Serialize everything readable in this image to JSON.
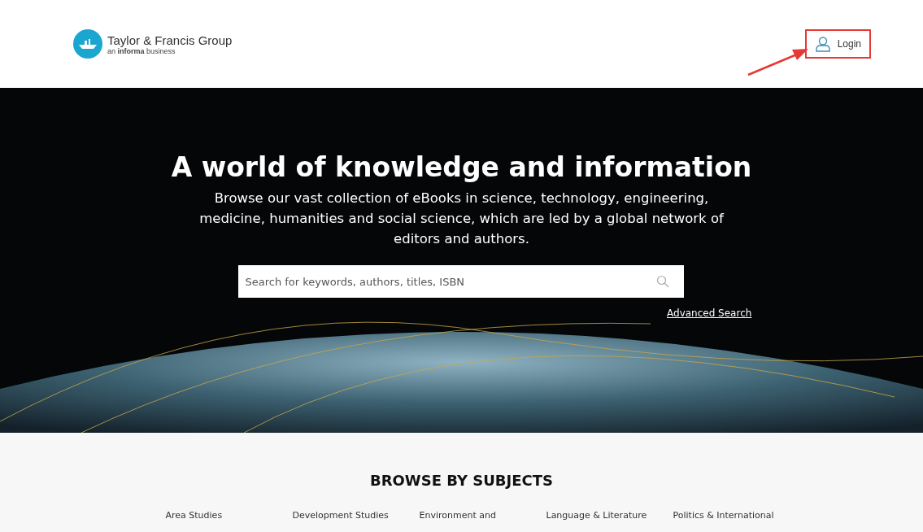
{
  "header": {
    "logo_title": "Taylor & Francis Group",
    "logo_tagline": "an **informa** business",
    "login": "Login"
  },
  "hero": {
    "title": "A world of knowledge and information",
    "description": "Browse our vast collection of eBooks in science, technology, engineering, medicine, humanities and social science, which are led by a global network of editors and authors.",
    "search": {
      "placeholder": "Search for keywords, authors, titles, ISBN"
    },
    "advanced_search": "Advanced Search"
  },
  "subjects": {
    "title": "BROWSE BY SUBJECTS",
    "items": [
      "Area Studies",
      "Development Studies",
      "Environment and",
      "Language & Literature",
      "Politics & International"
    ]
  }
}
